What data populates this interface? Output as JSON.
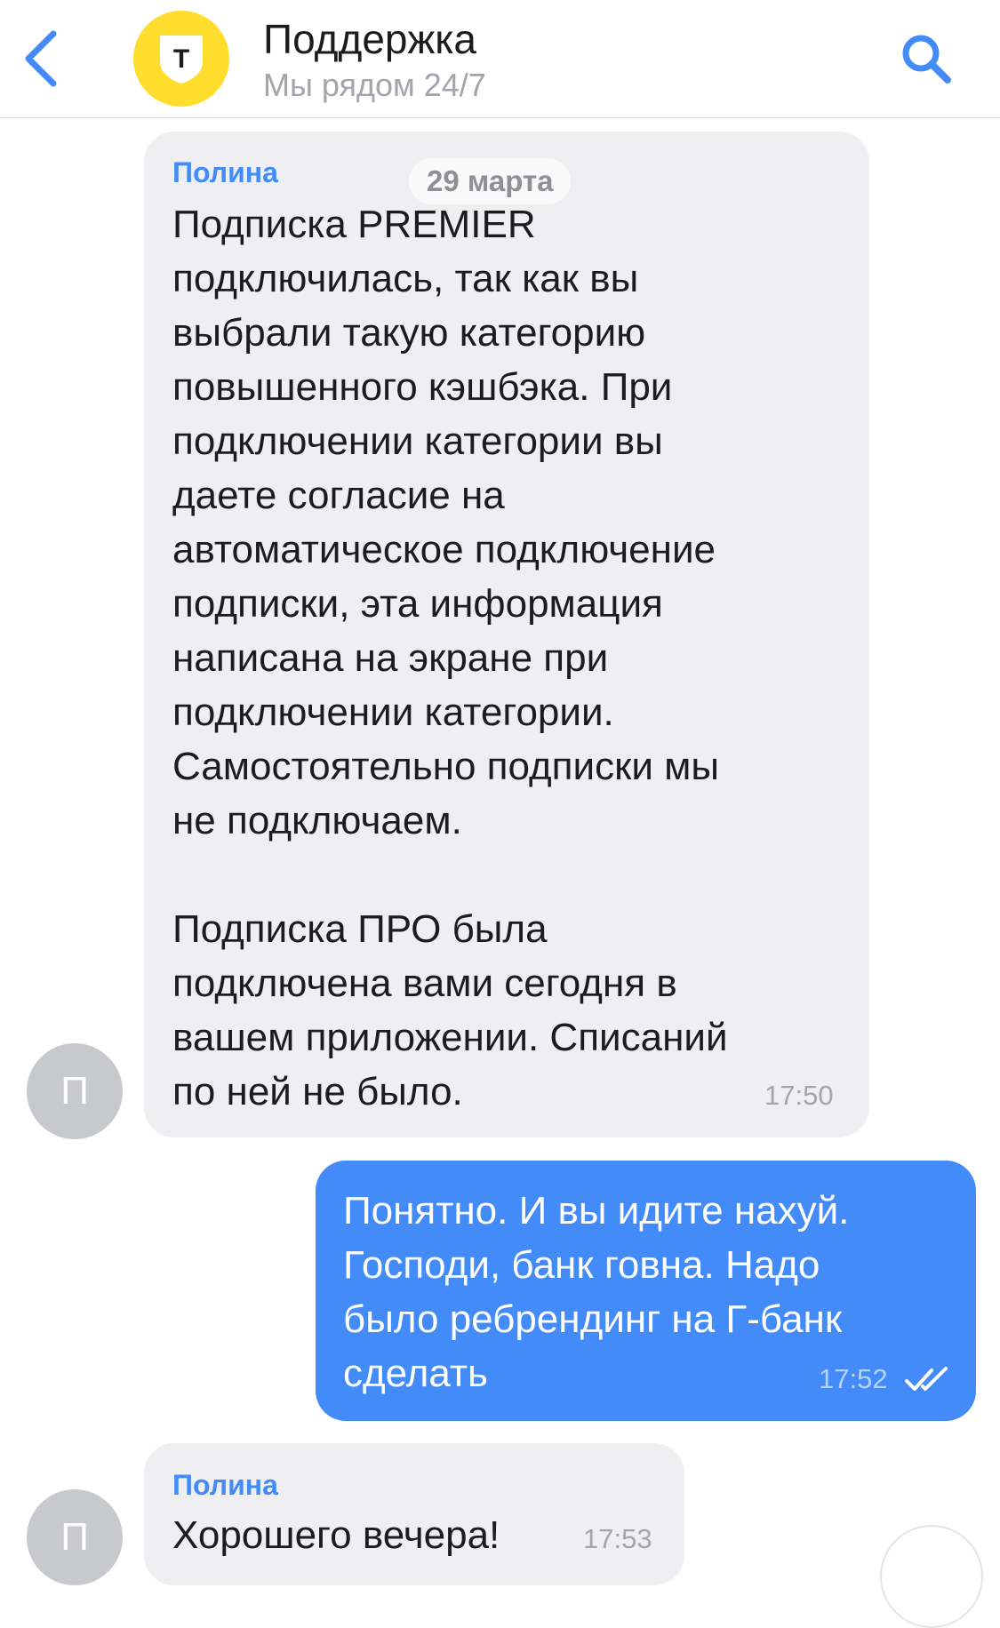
{
  "header": {
    "title": "Поддержка",
    "subtitle": "Мы рядом 24/7",
    "logo_letter": "Т",
    "icons": {
      "back": "chevron-left-icon",
      "search": "search-icon"
    },
    "accent_color": "#428bf9",
    "logo_color": "#ffdd2d"
  },
  "chat": {
    "date_separator": "29 марта",
    "messages": [
      {
        "direction": "incoming",
        "avatar_letter": "П",
        "sender": "Полина",
        "text": "Подписка PREMIER\nподключилась, так как вы\nвыбрали такую категорию\nповышенного кэшбэка. При\nподключении категории вы\nдаете согласие на\nавтоматическое подключение\nподписки, эта информация\nнаписана на экране при\nподключении категории.\nСамостоятельно подписки мы\nне подключаем.\n\nПодписка ПРО была\nподключена вами сегодня в\nвашем приложении. Списаний\nпо ней не было.",
        "time": "17:50"
      },
      {
        "direction": "outgoing",
        "text": "Понятно. И вы идите нахуй.\nГосподи, банк говна. Надо\nбыло ребрендинг на Г-банк\nсделать",
        "time": "17:52",
        "status": "read-double-check-icon"
      },
      {
        "direction": "incoming",
        "avatar_letter": "П",
        "sender": "Полина",
        "text": "Хорошего вечера!",
        "time": "17:53"
      }
    ]
  }
}
